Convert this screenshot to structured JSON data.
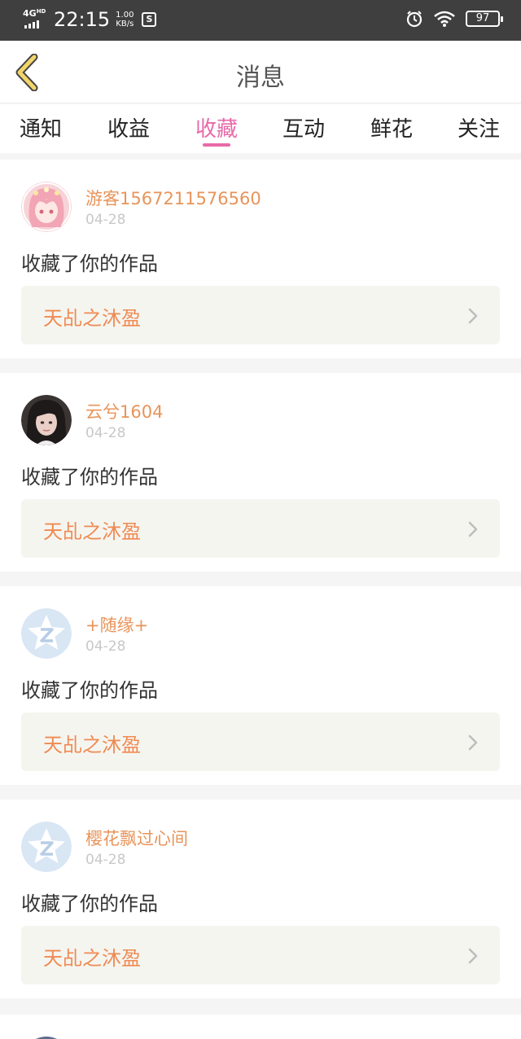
{
  "status_bar": {
    "network": "4G",
    "network_sup": "HD",
    "time": "22:15",
    "speed_value": "1.00",
    "speed_unit": "KB/s",
    "battery": "97",
    "icons": [
      "signal-icon",
      "screenshot-icon",
      "alarm-icon",
      "wifi-icon",
      "battery-icon"
    ]
  },
  "header": {
    "title": "消息",
    "back_icon": "chevron-left-icon"
  },
  "tabs": [
    {
      "label": "通知",
      "active": false
    },
    {
      "label": "收益",
      "active": false
    },
    {
      "label": "收藏",
      "active": true
    },
    {
      "label": "互动",
      "active": false
    },
    {
      "label": "鲜花",
      "active": false
    },
    {
      "label": "关注",
      "active": false
    }
  ],
  "items": [
    {
      "user": "游客1567211576560",
      "date": "04-28",
      "action": "收藏了你的作品",
      "work_title": "天乩之沐盈",
      "avatar": "anime-girl-avatar"
    },
    {
      "user": "云兮1604",
      "date": "04-28",
      "action": "收藏了你的作品",
      "work_title": "天乩之沐盈",
      "avatar": "photo-avatar"
    },
    {
      "user": "+随缘+",
      "date": "04-28",
      "action": "收藏了你的作品",
      "work_title": "天乩之沐盈",
      "avatar": "default-z-avatar"
    },
    {
      "user": "樱花飘过心间",
      "date": "04-28",
      "action": "收藏了你的作品",
      "work_title": "天乩之沐盈",
      "avatar": "default-z-avatar"
    }
  ],
  "colors": {
    "accent": "#e86aa8",
    "username": "#e8945a",
    "work_title": "#ef8a52",
    "back_arrow": "#f2d56a"
  }
}
